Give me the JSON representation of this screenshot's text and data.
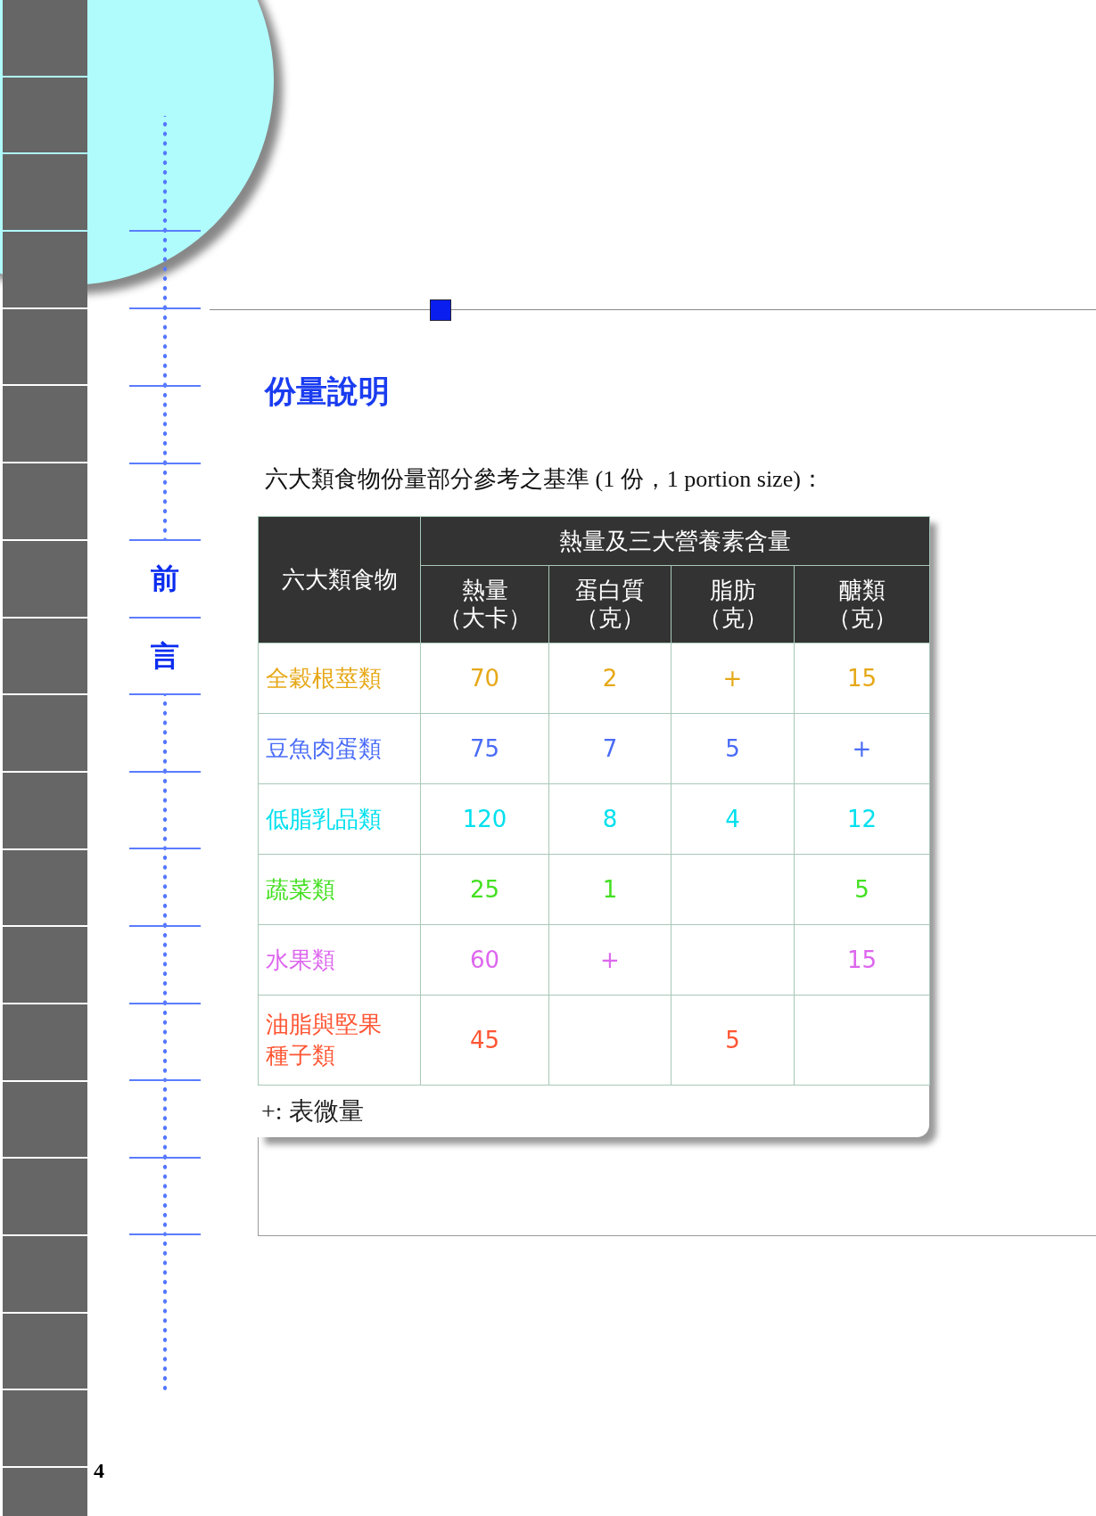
{
  "ruler": {
    "labels": [
      "前",
      "言"
    ]
  },
  "page_number": "4",
  "section_title": "份量說明",
  "intro": "六大類食物份量部分參考之基準 (1 份，1 portion size)：",
  "table": {
    "row_header": "六大類食物",
    "group_header": "熱量及三大營養素含量",
    "columns": [
      {
        "name": "熱量",
        "unit": "（大卡）"
      },
      {
        "name": "蛋白質",
        "unit": "（克）"
      },
      {
        "name": "脂肪",
        "unit": "（克）"
      },
      {
        "name": "醣類",
        "unit": "（克）"
      }
    ],
    "rows": [
      {
        "food": "全穀根莖類",
        "color": "#e6a817",
        "values": {
          "calories": "70",
          "protein": "2",
          "fat": "+",
          "carbs": "15"
        }
      },
      {
        "food": "豆魚肉蛋類",
        "color": "#4a6cf7",
        "values": {
          "calories": "75",
          "protein": "7",
          "fat": "5",
          "carbs": "+"
        }
      },
      {
        "food": "低脂乳品類",
        "color": "#00e0ee",
        "values": {
          "calories": "120",
          "protein": "8",
          "fat": "4",
          "carbs": "12"
        }
      },
      {
        "food": "蔬菜類",
        "color": "#44e022",
        "values": {
          "calories": "25",
          "protein": "1",
          "carbs": "5"
        }
      },
      {
        "food": "水果類",
        "color": "#dd66ee",
        "values": {
          "calories": "60",
          "protein": "+",
          "carbs": "15"
        }
      },
      {
        "food": "油脂與堅果種子類",
        "color": "#ff5533",
        "values": {
          "calories": "45",
          "fat": "5"
        }
      }
    ],
    "footnote": "+: 表微量"
  }
}
